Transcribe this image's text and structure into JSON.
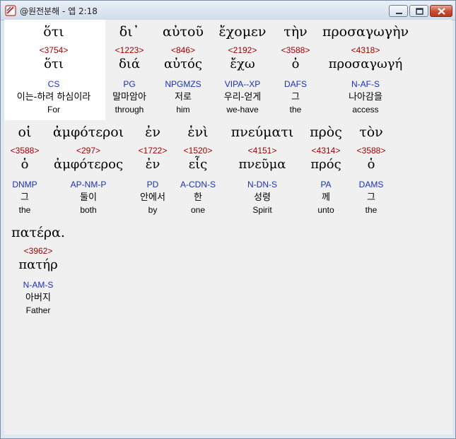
{
  "window": {
    "title": "@원전분해 - 엡 2:18"
  },
  "words": [
    {
      "greek": "ὅτι",
      "strong": "<3754>",
      "lemma": "ὅτι",
      "morph": "CS",
      "korean": "이는-하려 하심이라",
      "english": "For"
    },
    {
      "greek": "δι᾽",
      "strong": "<1223>",
      "lemma": "διά",
      "morph": "PG",
      "korean": "말마암아",
      "english": "through"
    },
    {
      "greek": "αὐτοῦ",
      "strong": "<846>",
      "lemma": "αὐτός",
      "morph": "NPGMZS",
      "korean": "저로",
      "english": "him"
    },
    {
      "greek": "ἔχομεν",
      "strong": "<2192>",
      "lemma": "ἔχω",
      "morph": "VIPA--XP",
      "korean": "우리-얻게",
      "english": "we-have"
    },
    {
      "greek": "τὴν",
      "strong": "<3588>",
      "lemma": "ὁ",
      "morph": "DAFS",
      "korean": "그",
      "english": "the"
    },
    {
      "greek": "προσαγωγὴν",
      "strong": "<4318>",
      "lemma": "προσαγωγή",
      "morph": "N-AF-S",
      "korean": "나아감을",
      "english": "access"
    },
    {
      "greek": "οἱ",
      "strong": "<3588>",
      "lemma": "ὁ",
      "morph": "DNMP",
      "korean": "그",
      "english": "the"
    },
    {
      "greek": "ἀμφότεροι",
      "strong": "<297>",
      "lemma": "ἀμφότερος",
      "morph": "AP-NM-P",
      "korean": "둘이",
      "english": "both"
    },
    {
      "greek": "ἐν",
      "strong": "<1722>",
      "lemma": "ἐν",
      "morph": "PD",
      "korean": "안에서",
      "english": "by"
    },
    {
      "greek": "ἑνὶ",
      "strong": "<1520>",
      "lemma": "εἷς",
      "morph": "A-CDN-S",
      "korean": "한",
      "english": "one"
    },
    {
      "greek": "πνεύματι",
      "strong": "<4151>",
      "lemma": "πνεῦμα",
      "morph": "N-DN-S",
      "korean": "성령",
      "english": "Spirit"
    },
    {
      "greek": "πρὸς",
      "strong": "<4314>",
      "lemma": "πρός",
      "morph": "PA",
      "korean": "께",
      "english": "unto"
    },
    {
      "greek": "τὸν",
      "strong": "<3588>",
      "lemma": "ὁ",
      "morph": "DAMS",
      "korean": "그",
      "english": "the"
    },
    {
      "greek": "πατέρα.",
      "strong": "<3962>",
      "lemma": "πατήρ",
      "morph": "N-AM-S",
      "korean": "아버지",
      "english": "Father"
    }
  ]
}
